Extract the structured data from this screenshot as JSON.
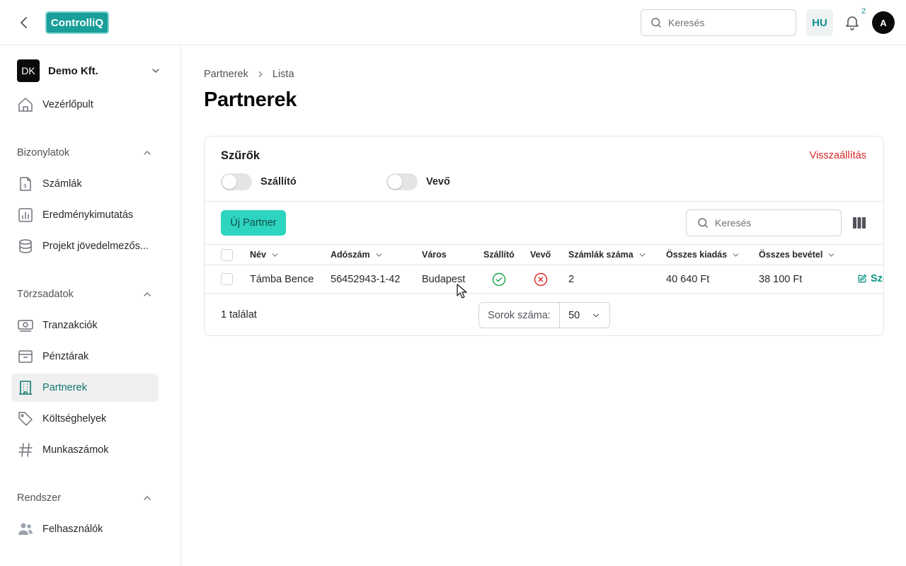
{
  "header": {
    "logo_text": "ControlliQ",
    "search_placeholder": "Keresés",
    "language": "HU",
    "notification_count": "2",
    "avatar_initial": "A"
  },
  "sidebar": {
    "company": {
      "initials": "DK",
      "name": "Demo Kft."
    },
    "dashboard": "Vezérlőpult",
    "sections": [
      {
        "title": "Bizonylatok",
        "items": [
          "Számlák",
          "Eredménykimutatás",
          "Projekt jövedelmezős..."
        ]
      },
      {
        "title": "Törzsadatok",
        "items": [
          "Tranzakciók",
          "Pénztárak",
          "Partnerek",
          "Költséghelyek",
          "Munkaszámok"
        ]
      },
      {
        "title": "Rendszer",
        "items": [
          "Felhasználók"
        ]
      }
    ],
    "active_item": "Partnerek"
  },
  "breadcrumb": [
    "Partnerek",
    "Lista"
  ],
  "page_title": "Partnerek",
  "filters": {
    "title": "Szűrők",
    "reset_label": "Visszaállítás",
    "toggles": [
      {
        "label": "Szállító",
        "on": false
      },
      {
        "label": "Vevő",
        "on": false
      }
    ]
  },
  "toolbar": {
    "new_button": "Új Partner",
    "search_placeholder": "Keresés"
  },
  "table": {
    "columns": [
      "Név",
      "Adószám",
      "Város",
      "Szállító",
      "Vevő",
      "Számlák száma",
      "Összes kiadás",
      "Összes bevétel"
    ],
    "rows": [
      {
        "name": "Támba Bence",
        "tax_number": "56452943-1-42",
        "city": "Budapest",
        "supplier": true,
        "customer": false,
        "invoice_count": "2",
        "total_expense": "40 640 Ft",
        "total_income": "38 100 Ft",
        "action": "Sze"
      }
    ]
  },
  "footer": {
    "results": "1 találat",
    "rows_label": "Sorok száma:",
    "rows_value": "50"
  },
  "colors": {
    "accent": "#2dd4bf",
    "brand": "#1a9e9a",
    "success": "#16a34a",
    "danger": "#dc2626"
  }
}
